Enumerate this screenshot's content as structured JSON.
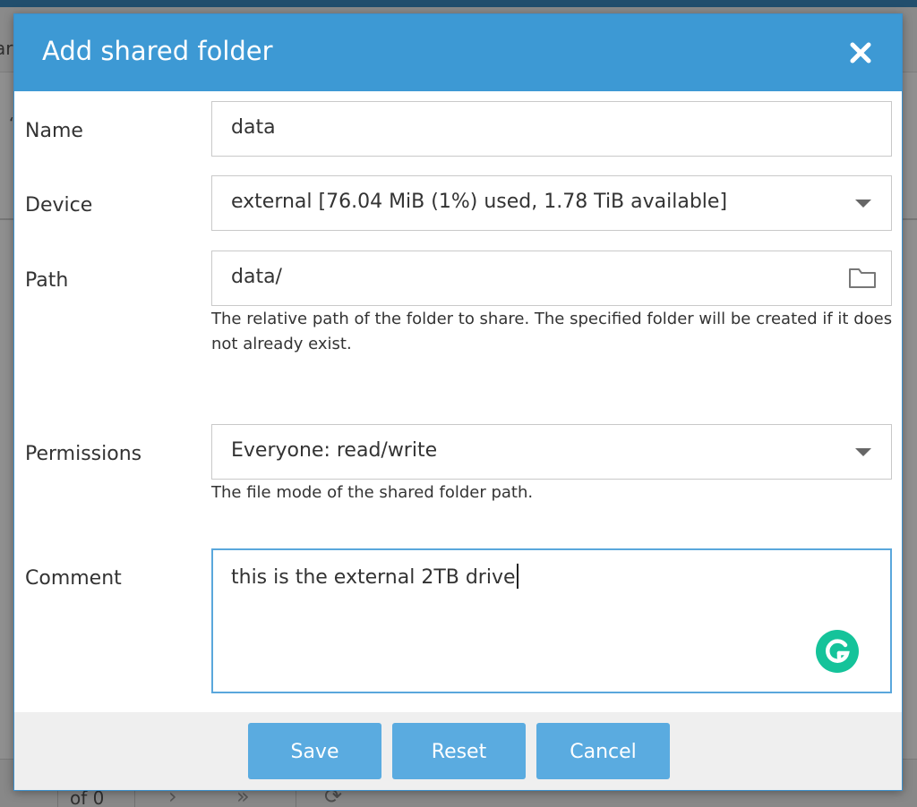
{
  "background": {
    "toolbar_fragment": "ar",
    "row_fragment": "‘",
    "pager_of": "of 0",
    "pager_next": "›",
    "pager_last": "»",
    "pager_refresh": "⟳"
  },
  "dialog": {
    "title": "Add shared folder",
    "close_icon": "close-icon",
    "fields": {
      "name": {
        "label": "Name",
        "value": "data"
      },
      "device": {
        "label": "Device",
        "value": "external [76.04 MiB (1%) used, 1.78 TiB available]"
      },
      "path": {
        "label": "Path",
        "value": "data/",
        "help": "The relative path of the folder to share. The specified folder will be created if it does not already exist."
      },
      "permissions": {
        "label": "Permissions",
        "value": "Everyone: read/write",
        "help": "The file mode of the shared folder path."
      },
      "comment": {
        "label": "Comment",
        "value": "this is the external 2TB drive"
      }
    },
    "buttons": {
      "save": "Save",
      "reset": "Reset",
      "cancel": "Cancel"
    }
  },
  "colors": {
    "header": "#3d99d4",
    "button": "#5aabe0",
    "focus_border": "#5aa7dc",
    "grammarly": "#15c39a"
  }
}
